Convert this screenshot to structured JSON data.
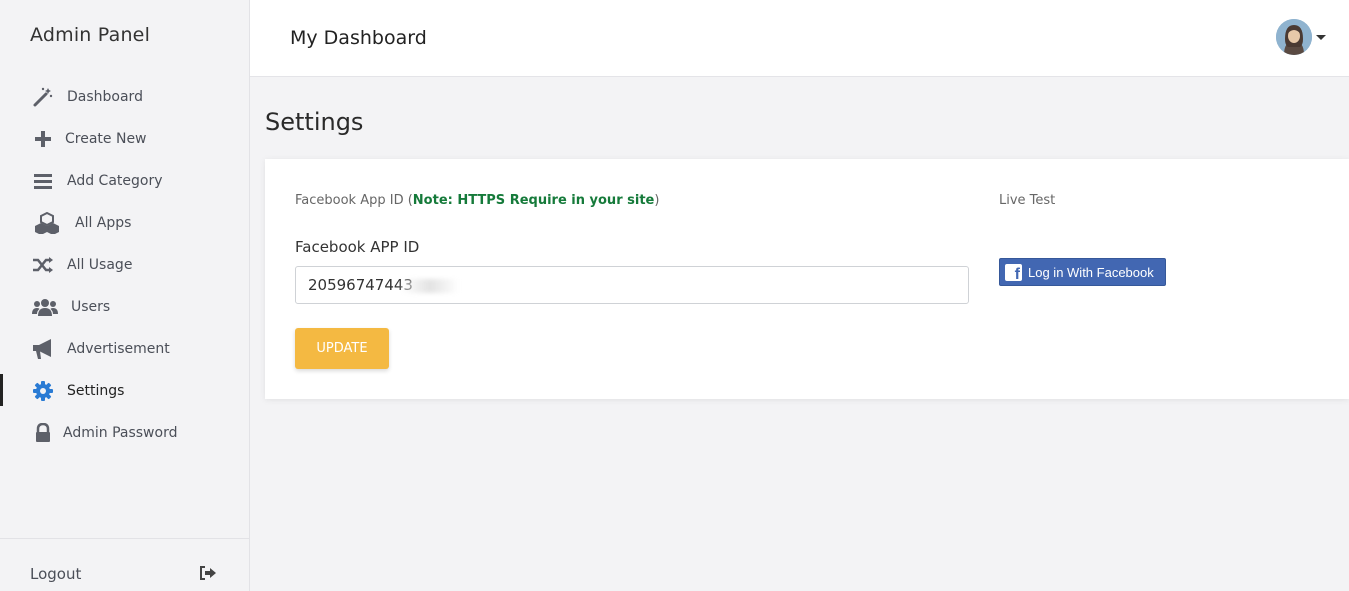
{
  "sidebar": {
    "brand": "Admin Panel",
    "items": [
      {
        "label": "Dashboard",
        "icon": "magic-wand-icon"
      },
      {
        "label": "Create New",
        "icon": "plus-icon"
      },
      {
        "label": "Add Category",
        "icon": "list-icon"
      },
      {
        "label": "All Apps",
        "icon": "cubes-icon"
      },
      {
        "label": "All Usage",
        "icon": "shuffle-icon"
      },
      {
        "label": "Users",
        "icon": "users-icon"
      },
      {
        "label": "Advertisement",
        "icon": "megaphone-icon"
      },
      {
        "label": "Settings",
        "icon": "gear-icon",
        "active": true
      },
      {
        "label": "Admin Password",
        "icon": "lock-icon"
      }
    ],
    "logout_label": "Logout"
  },
  "header": {
    "title": "My Dashboard"
  },
  "main": {
    "page_title": "Settings",
    "caption_prefix": "Facebook App ID (",
    "caption_note": "Note: HTTPS Require in your site",
    "caption_suffix": ")",
    "field_label": "Facebook APP ID",
    "app_id_value": "20596747443",
    "update_label": "UPDATE",
    "live_test_label": "Live Test",
    "fb_button_label": "Log in With Facebook"
  },
  "colors": {
    "accent": "#2a7bd4",
    "update_button": "#f4b942",
    "note_green": "#157a3a",
    "facebook_blue": "#4267b2"
  }
}
